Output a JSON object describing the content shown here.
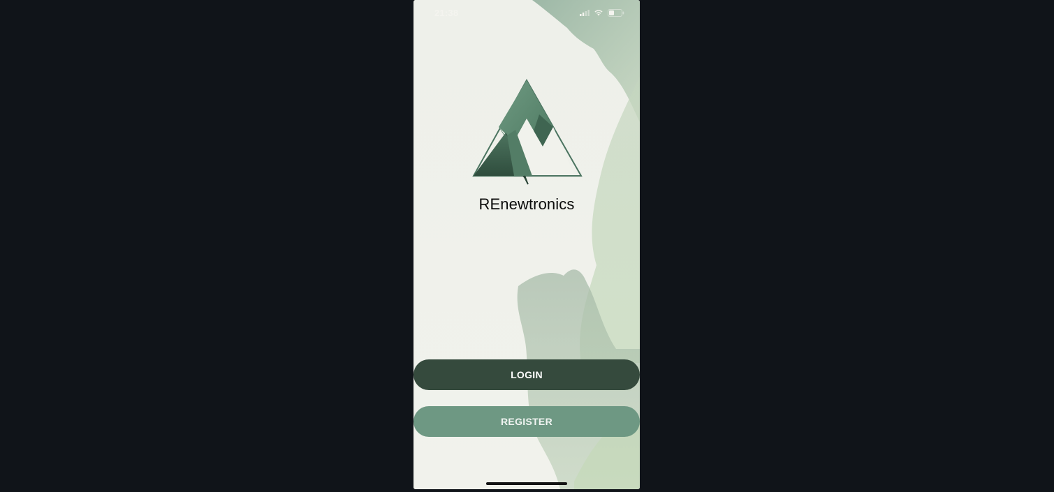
{
  "status_bar": {
    "time": "21:38",
    "icons": [
      "signal-icon",
      "wifi-icon",
      "battery-icon"
    ]
  },
  "brand": {
    "name": "REnewtronics",
    "logo_icon": "mountain-logo-icon"
  },
  "actions": {
    "login_label": "LOGIN",
    "register_label": "REGISTER"
  },
  "colors": {
    "page_background": "#101419",
    "paper_background": "#eeefe9",
    "login_button": "#354a3d",
    "register_button": "#6e9883",
    "logo_green": "#5f8a72",
    "logo_dark": "#355544"
  }
}
